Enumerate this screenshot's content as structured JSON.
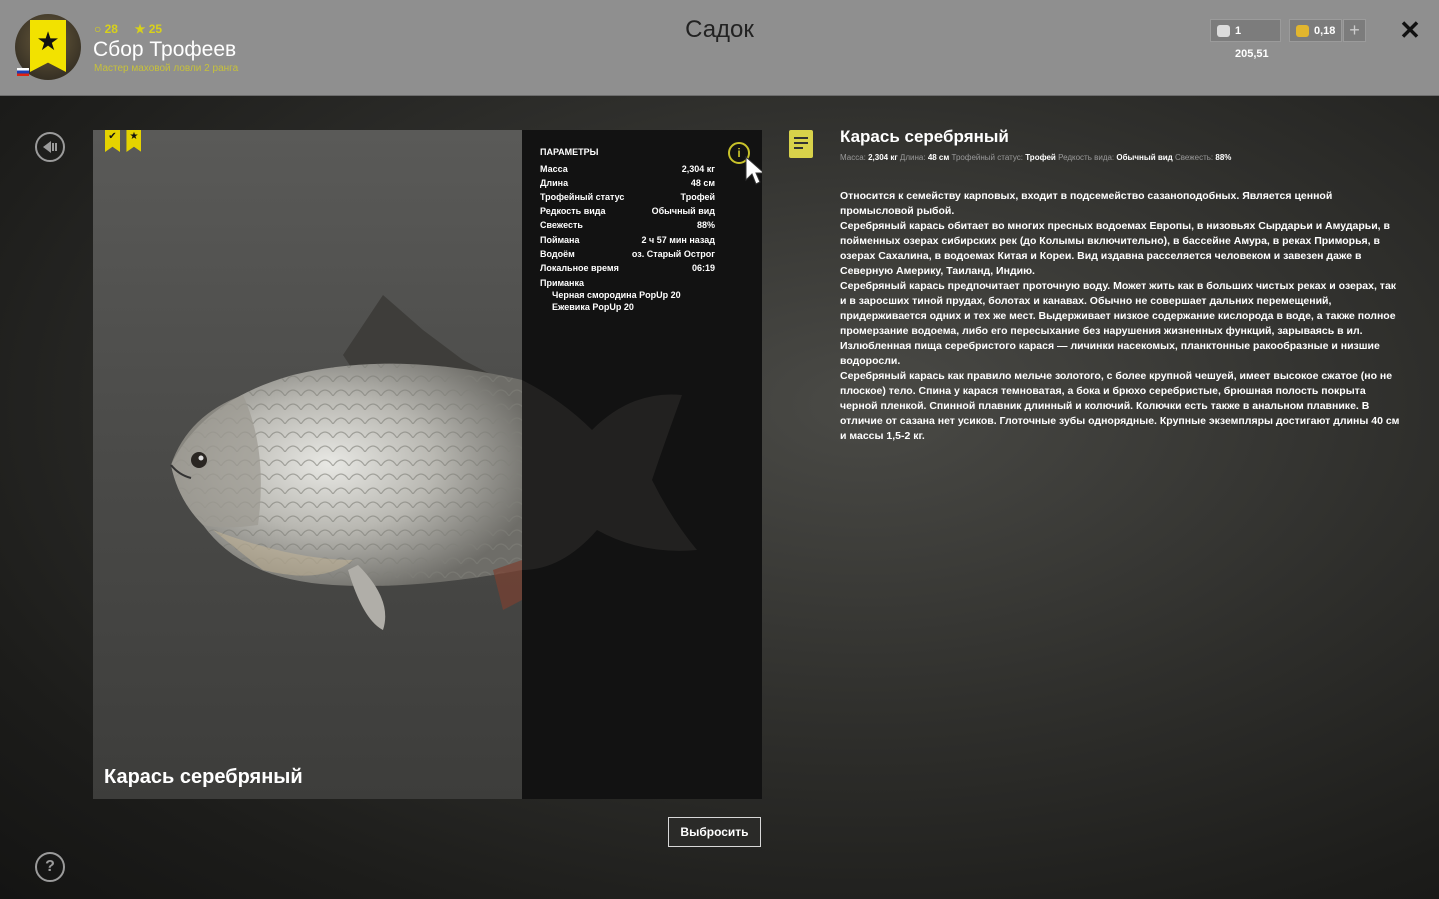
{
  "header": {
    "title": "Садок",
    "player": {
      "name": "Сбор Трофеев",
      "rank": "Мастер маховой ловли 2 ранга",
      "level": "28",
      "stars": "25"
    },
    "wallet": {
      "silver": "1 205,51",
      "gold": "0,18"
    },
    "plus_label": "+",
    "close_label": "✕"
  },
  "nav": {
    "back_icon": "back-arrow-icon",
    "help_label": "?"
  },
  "fish": {
    "name": "Карась серебряный",
    "params_title": "ПАРАМЕТРЫ",
    "params": [
      {
        "key": "Масса",
        "value": "2,304 кг"
      },
      {
        "key": "Длина",
        "value": "48 см"
      },
      {
        "key": "Трофейный статус",
        "value": "Трофей"
      },
      {
        "key": "Редкость вида",
        "value": "Обычный вид"
      },
      {
        "key": "Свежесть",
        "value": "88%"
      },
      {
        "key": "Поймана",
        "value": "2 ч 57 мин назад"
      },
      {
        "key": "Водоём",
        "value": "оз. Старый Острог"
      },
      {
        "key": "Локальное время",
        "value": "06:19"
      }
    ],
    "bait_label": "Приманка",
    "baits": [
      "Черная смородина PopUp 20",
      "Ежевика PopUp 20"
    ],
    "release_label": "Выбросить"
  },
  "description": {
    "title": "Карась серебряный",
    "meta": {
      "mass_label": "Масса:",
      "mass_value": "2,304 кг",
      "length_label": "Длина:",
      "length_value": "48 см",
      "trophy_label": "Трофейный статус:",
      "trophy_value": "Трофей",
      "rarity_label": "Редкость вида:",
      "rarity_value": "Обычный вид",
      "fresh_label": "Свежесть:",
      "fresh_value": "88%"
    },
    "paragraphs": [
      "Относится к семейству карповых, входит в подсемейство сазаноподобных. Является ценной промысловой рыбой.",
      "Серебряный карась обитает во многих пресных водоемах Европы, в низовьях Сырдарьи и Амударьи, в пойменных озерах сибирских рек (до Колымы включительно), в бассейне Амура, в реках Приморья, в озерах Сахалина, в водоемах Китая и Кореи. Вид издавна расселяется человеком и завезен даже в Северную Америку, Таиланд, Индию.",
      "Серебряный карась предпочитает проточную воду. Может жить как в больших чистых реках и озерах, так и в заросших тиной прудах, болотах и канавах. Обычно не совершает дальних перемещений, придерживается одних и тех же мест. Выдерживает низкое содержание кислорода в воде, а также полное промерзание водоема, либо его пересыхание без нарушения жизненных функций, зарываясь в ил. Излюбленная пища серебристого карася — личинки насекомых, планктонные ракообразные и низшие водоросли.",
      "Серебряный карась как правило мельче золотого, с более крупной чешуей, имеет высокое сжатое (но не плоское) тело. Спина у карася темноватая, а бока и брюхо серебристые, брюшная полость покрыта черной пленкой. Спинной плавник длинный и колючий. Колючки есть также в анальном плавнике. В отличие от сазана нет усиков. Глоточные зубы однорядные. Крупные экземпляры достигают длины 40 см и массы 1,5-2 кг."
    ]
  },
  "colors": {
    "accent": "#d8d11a",
    "topbar": "#8f8f8f",
    "params_bg": "#121212"
  }
}
